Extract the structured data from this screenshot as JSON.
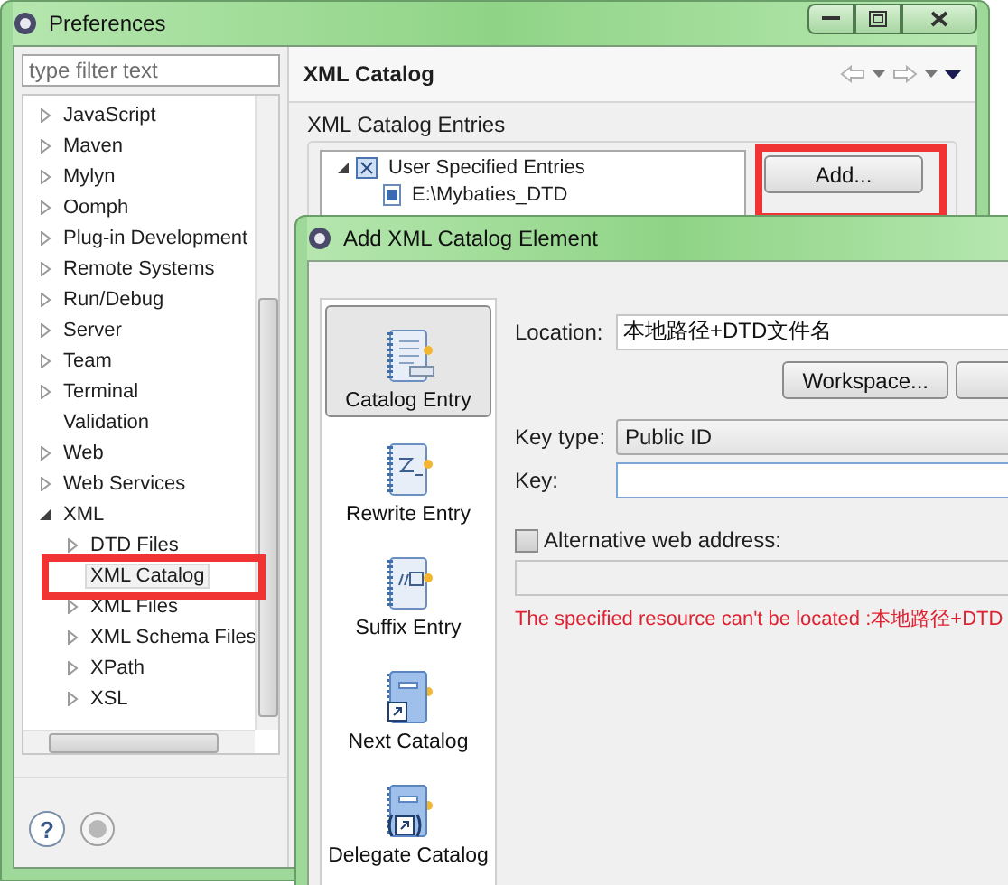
{
  "preferences": {
    "title": "Preferences",
    "filter": {
      "placeholder": "type filter text"
    },
    "tree": [
      {
        "label": "JavaScript",
        "kind": "folder",
        "expanded": false
      },
      {
        "label": "Maven",
        "kind": "folder",
        "expanded": false
      },
      {
        "label": "Mylyn",
        "kind": "folder",
        "expanded": false
      },
      {
        "label": "Oomph",
        "kind": "folder",
        "expanded": false
      },
      {
        "label": "Plug-in Development",
        "kind": "folder",
        "expanded": false
      },
      {
        "label": "Remote Systems",
        "kind": "folder",
        "expanded": false
      },
      {
        "label": "Run/Debug",
        "kind": "folder",
        "expanded": false
      },
      {
        "label": "Server",
        "kind": "folder",
        "expanded": false
      },
      {
        "label": "Team",
        "kind": "folder",
        "expanded": false
      },
      {
        "label": "Terminal",
        "kind": "folder",
        "expanded": false
      },
      {
        "label": "Validation",
        "kind": "leaf",
        "selected": false
      },
      {
        "label": "Web",
        "kind": "folder",
        "expanded": false
      },
      {
        "label": "Web Services",
        "kind": "folder",
        "expanded": false
      },
      {
        "label": "XML",
        "kind": "folder",
        "expanded": true,
        "children": [
          {
            "label": "DTD Files",
            "kind": "folder",
            "expanded": false
          },
          {
            "label": "XML Catalog",
            "kind": "leaf",
            "selected": true
          },
          {
            "label": "XML Files",
            "kind": "folder",
            "expanded": false
          },
          {
            "label": "XML Schema Files",
            "kind": "folder",
            "expanded": false
          },
          {
            "label": "XPath",
            "kind": "folder",
            "expanded": false
          },
          {
            "label": "XSL",
            "kind": "folder",
            "expanded": false
          }
        ]
      }
    ],
    "help_button": "?",
    "page": {
      "title": "XML Catalog",
      "group": "XML Catalog Entries",
      "entries": [
        {
          "label": "User Specified Entries",
          "expanded": true,
          "children": [
            {
              "label": "E:\\Mybaties_DTD"
            }
          ]
        }
      ],
      "add_button": "Add..."
    }
  },
  "dialog": {
    "title": "Add XML Catalog Element",
    "types": [
      {
        "label": "Catalog Entry",
        "kind": "catalog",
        "selected": true
      },
      {
        "label": "Rewrite Entry",
        "kind": "rewrite",
        "selected": false
      },
      {
        "label": "Suffix Entry",
        "kind": "suffix",
        "selected": false
      },
      {
        "label": "Next Catalog",
        "kind": "next",
        "selected": false
      },
      {
        "label": "Delegate Catalog",
        "kind": "delegate",
        "selected": false
      }
    ],
    "location": {
      "label": "Location:",
      "value": "本地路径+DTD文件名"
    },
    "workspace_button": "Workspace...",
    "key_type": {
      "label": "Key type:",
      "value": "Public ID"
    },
    "key": {
      "label": "Key:"
    },
    "alternative": {
      "label": "Alternative web address:",
      "checked": false
    },
    "error": "The specified resource can't be located :本地路径+DTD"
  }
}
